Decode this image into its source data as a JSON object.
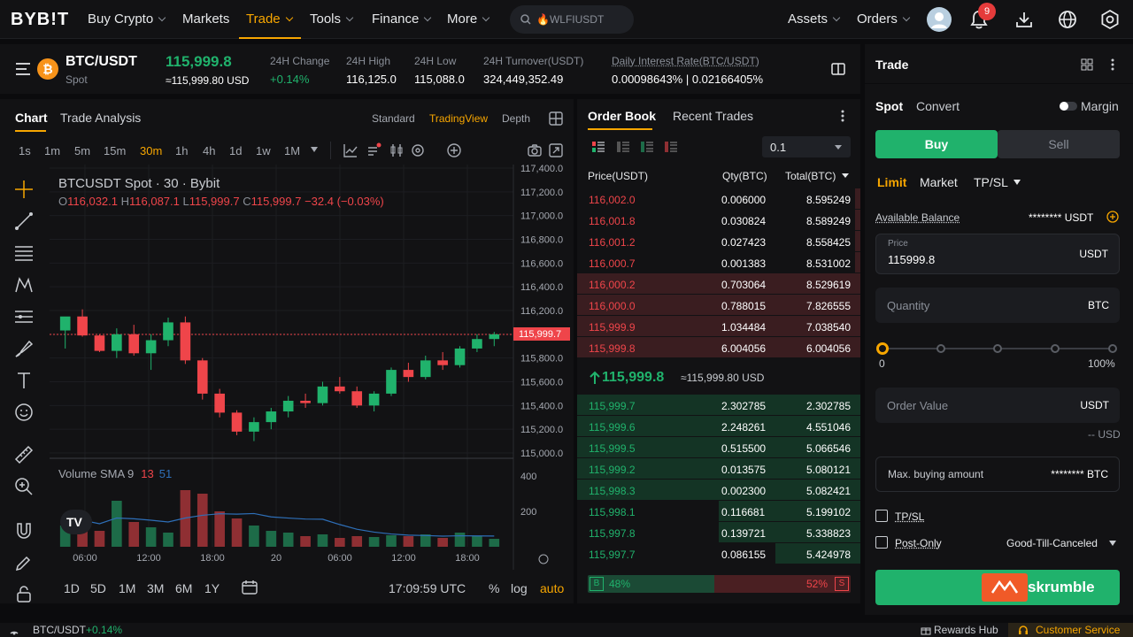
{
  "nav": {
    "logo": "BYB!T",
    "items": [
      {
        "label": "Buy Crypto",
        "dropdown": true
      },
      {
        "label": "Markets",
        "dropdown": false
      },
      {
        "label": "Trade",
        "dropdown": true,
        "active": true
      },
      {
        "label": "Tools",
        "dropdown": true
      },
      {
        "label": "Finance",
        "dropdown": true
      },
      {
        "label": "More",
        "dropdown": true
      }
    ],
    "search_placeholder": "🔥WLFIUSDT",
    "assets_label": "Assets",
    "orders_label": "Orders",
    "notification_count": "9"
  },
  "ticker": {
    "pair": "BTC/USDT",
    "market": "Spot",
    "coin_symbol": "₿",
    "price": "115,999.8",
    "price_usd": "≈115,999.80 USD",
    "stats": [
      {
        "label": "24H Change",
        "value": "+0.14%",
        "color": "#20b26c"
      },
      {
        "label": "24H High",
        "value": "116,125.0"
      },
      {
        "label": "24H Low",
        "value": "115,088.0"
      },
      {
        "label": "24H Turnover(USDT)",
        "value": "324,449,352.49"
      },
      {
        "label": "Daily Interest Rate(BTC/USDT)",
        "value": "0.00098643% | 0.02166405%"
      }
    ]
  },
  "chart_panel": {
    "tabs": [
      "Chart",
      "Trade Analysis"
    ],
    "views": [
      "Standard",
      "TradingView",
      "Depth"
    ],
    "timeframes": [
      "1s",
      "1m",
      "5m",
      "15m",
      "30m",
      "1h",
      "4h",
      "1d",
      "1w",
      "1M"
    ],
    "active_timeframe": "30m",
    "symbol_title": "BTCUSDT Spot · 30 · Bybit",
    "ohlc": {
      "o": "116,032.1",
      "h": "116,087.1",
      "l": "115,999.7",
      "c": "115,999.7",
      "chg": "−32.4 (−0.03%)"
    },
    "volume_label": "Volume SMA 9",
    "volume_v1": "13",
    "volume_v2": "51",
    "current_price_tag": "115,999.7",
    "ranges": [
      "1D",
      "5D",
      "1M",
      "3M",
      "6M",
      "1Y"
    ],
    "clock": "17:09:59 UTC",
    "scale_opts": [
      "%",
      "log",
      "auto"
    ]
  },
  "chart_data": {
    "type": "candlestick",
    "title": "BTCUSDT Spot · 30 · Bybit",
    "y_ticks": [
      "117,400.0",
      "117,200.0",
      "117,000.0",
      "116,800.0",
      "116,600.0",
      "116,400.0",
      "116,200.0",
      "116,000.0",
      "115,800.0",
      "115,600.0",
      "115,400.0",
      "115,200.0",
      "115,000.0"
    ],
    "ylim": [
      115000,
      117400
    ],
    "x_ticks": [
      "06:00",
      "12:00",
      "18:00",
      "20",
      "06:00",
      "12:00",
      "18:00"
    ],
    "volume_ticks": [
      "400",
      "200"
    ],
    "candles": [
      {
        "o": 116032,
        "h": 116087,
        "l": 115880,
        "c": 116150
      },
      {
        "o": 116150,
        "h": 116210,
        "l": 115980,
        "c": 115990
      },
      {
        "o": 115990,
        "h": 116000,
        "l": 115850,
        "c": 115860
      },
      {
        "o": 115860,
        "h": 116050,
        "l": 115800,
        "c": 116000
      },
      {
        "o": 116000,
        "h": 116080,
        "l": 115820,
        "c": 115840
      },
      {
        "o": 115840,
        "h": 116000,
        "l": 115700,
        "c": 115950
      },
      {
        "o": 115950,
        "h": 116140,
        "l": 115900,
        "c": 116100
      },
      {
        "o": 116100,
        "h": 116150,
        "l": 115750,
        "c": 115780
      },
      {
        "o": 115780,
        "h": 115800,
        "l": 115450,
        "c": 115500
      },
      {
        "o": 115500,
        "h": 115540,
        "l": 115300,
        "c": 115340
      },
      {
        "o": 115340,
        "h": 115360,
        "l": 115150,
        "c": 115180
      },
      {
        "o": 115180,
        "h": 115300,
        "l": 115100,
        "c": 115260
      },
      {
        "o": 115260,
        "h": 115380,
        "l": 115200,
        "c": 115350
      },
      {
        "o": 115350,
        "h": 115480,
        "l": 115300,
        "c": 115440
      },
      {
        "o": 115440,
        "h": 115500,
        "l": 115380,
        "c": 115420
      },
      {
        "o": 115420,
        "h": 115600,
        "l": 115400,
        "c": 115560
      },
      {
        "o": 115560,
        "h": 115640,
        "l": 115500,
        "c": 115520
      },
      {
        "o": 115520,
        "h": 115560,
        "l": 115380,
        "c": 115400
      },
      {
        "o": 115400,
        "h": 115520,
        "l": 115350,
        "c": 115500
      },
      {
        "o": 115500,
        "h": 115720,
        "l": 115480,
        "c": 115700
      },
      {
        "o": 115700,
        "h": 115760,
        "l": 115600,
        "c": 115640
      },
      {
        "o": 115640,
        "h": 115820,
        "l": 115620,
        "c": 115780
      },
      {
        "o": 115780,
        "h": 115850,
        "l": 115700,
        "c": 115740
      },
      {
        "o": 115740,
        "h": 115900,
        "l": 115720,
        "c": 115880
      },
      {
        "o": 115880,
        "h": 116000,
        "l": 115850,
        "c": 115960
      },
      {
        "o": 115960,
        "h": 116020,
        "l": 115900,
        "c": 115999.7
      }
    ],
    "volumes": [
      120,
      180,
      90,
      260,
      140,
      110,
      80,
      320,
      300,
      200,
      160,
      120,
      90,
      80,
      60,
      70,
      50,
      60,
      55,
      65,
      60,
      70,
      50,
      80,
      60,
      45
    ]
  },
  "orderbook": {
    "tabs": [
      "Order Book",
      "Recent Trades"
    ],
    "precision": "0.1",
    "headers": [
      "Price(USDT)",
      "Qty(BTC)",
      "Total(BTC)"
    ],
    "asks": [
      {
        "price": "116,002.0",
        "qty": "0.006000",
        "total": "8.595249",
        "depth": 0.02
      },
      {
        "price": "116,001.8",
        "qty": "0.030824",
        "total": "8.589249",
        "depth": 0.02
      },
      {
        "price": "116,001.2",
        "qty": "0.027423",
        "total": "8.558425",
        "depth": 0.02
      },
      {
        "price": "116,000.7",
        "qty": "0.001383",
        "total": "8.531002",
        "depth": 0.02
      },
      {
        "price": "116,000.2",
        "qty": "0.703064",
        "total": "8.529619",
        "depth": 1.0
      },
      {
        "price": "116,000.0",
        "qty": "0.788015",
        "total": "7.826555",
        "depth": 1.0
      },
      {
        "price": "115,999.9",
        "qty": "1.034484",
        "total": "7.038540",
        "depth": 1.0
      },
      {
        "price": "115,999.8",
        "qty": "6.004056",
        "total": "6.004056",
        "depth": 1.0
      }
    ],
    "mid_price": "115,999.8",
    "mid_usd": "≈115,999.80 USD",
    "bids": [
      {
        "price": "115,999.7",
        "qty": "2.302785",
        "total": "2.302785",
        "depth": 1.0
      },
      {
        "price": "115,999.6",
        "qty": "2.248261",
        "total": "4.551046",
        "depth": 1.0
      },
      {
        "price": "115,999.5",
        "qty": "0.515500",
        "total": "5.066546",
        "depth": 1.0
      },
      {
        "price": "115,999.2",
        "qty": "0.013575",
        "total": "5.080121",
        "depth": 1.0
      },
      {
        "price": "115,998.3",
        "qty": "0.002300",
        "total": "5.082421",
        "depth": 1.0
      },
      {
        "price": "115,998.1",
        "qty": "0.116681",
        "total": "5.199102",
        "depth": 0.5
      },
      {
        "price": "115,997.8",
        "qty": "0.139721",
        "total": "5.338823",
        "depth": 0.5
      },
      {
        "price": "115,997.7",
        "qty": "0.086155",
        "total": "5.424978",
        "depth": 0.3
      }
    ],
    "buy_pct": "48%",
    "sell_pct": "52%",
    "buy_tag": "B",
    "sell_tag": "S"
  },
  "trade": {
    "title": "Trade",
    "modes": [
      "Spot",
      "Convert"
    ],
    "margin_label": "Margin",
    "buy_label": "Buy",
    "sell_label": "Sell",
    "order_types": [
      "Limit",
      "Market",
      "TP/SL"
    ],
    "available_label": "Available Balance",
    "available_value": "******** USDT",
    "price_label": "Price",
    "price_value": "115999.8",
    "price_unit": "USDT",
    "qty_placeholder": "Quantity",
    "qty_unit": "BTC",
    "slider_min": "0",
    "slider_max": "100%",
    "slider_value": 0,
    "order_value_placeholder": "Order Value",
    "order_value_unit": "USDT",
    "order_value_usd": "-- USD",
    "max_buy_label": "Max. buying amount",
    "max_buy_value": "******** BTC",
    "tpsl_label": "TP/SL",
    "postonly_label": "Post-Only",
    "tif_label": "Good-Till-Canceled",
    "submit_brand": "skrumble"
  },
  "footer": {
    "pair": "BTC/USDT",
    "change": "+0.14%",
    "rewards": "Rewards Hub",
    "support": "Customer Service"
  },
  "colors": {
    "up": "#20b26c",
    "down": "#ef454a",
    "accent": "#f7a600"
  }
}
